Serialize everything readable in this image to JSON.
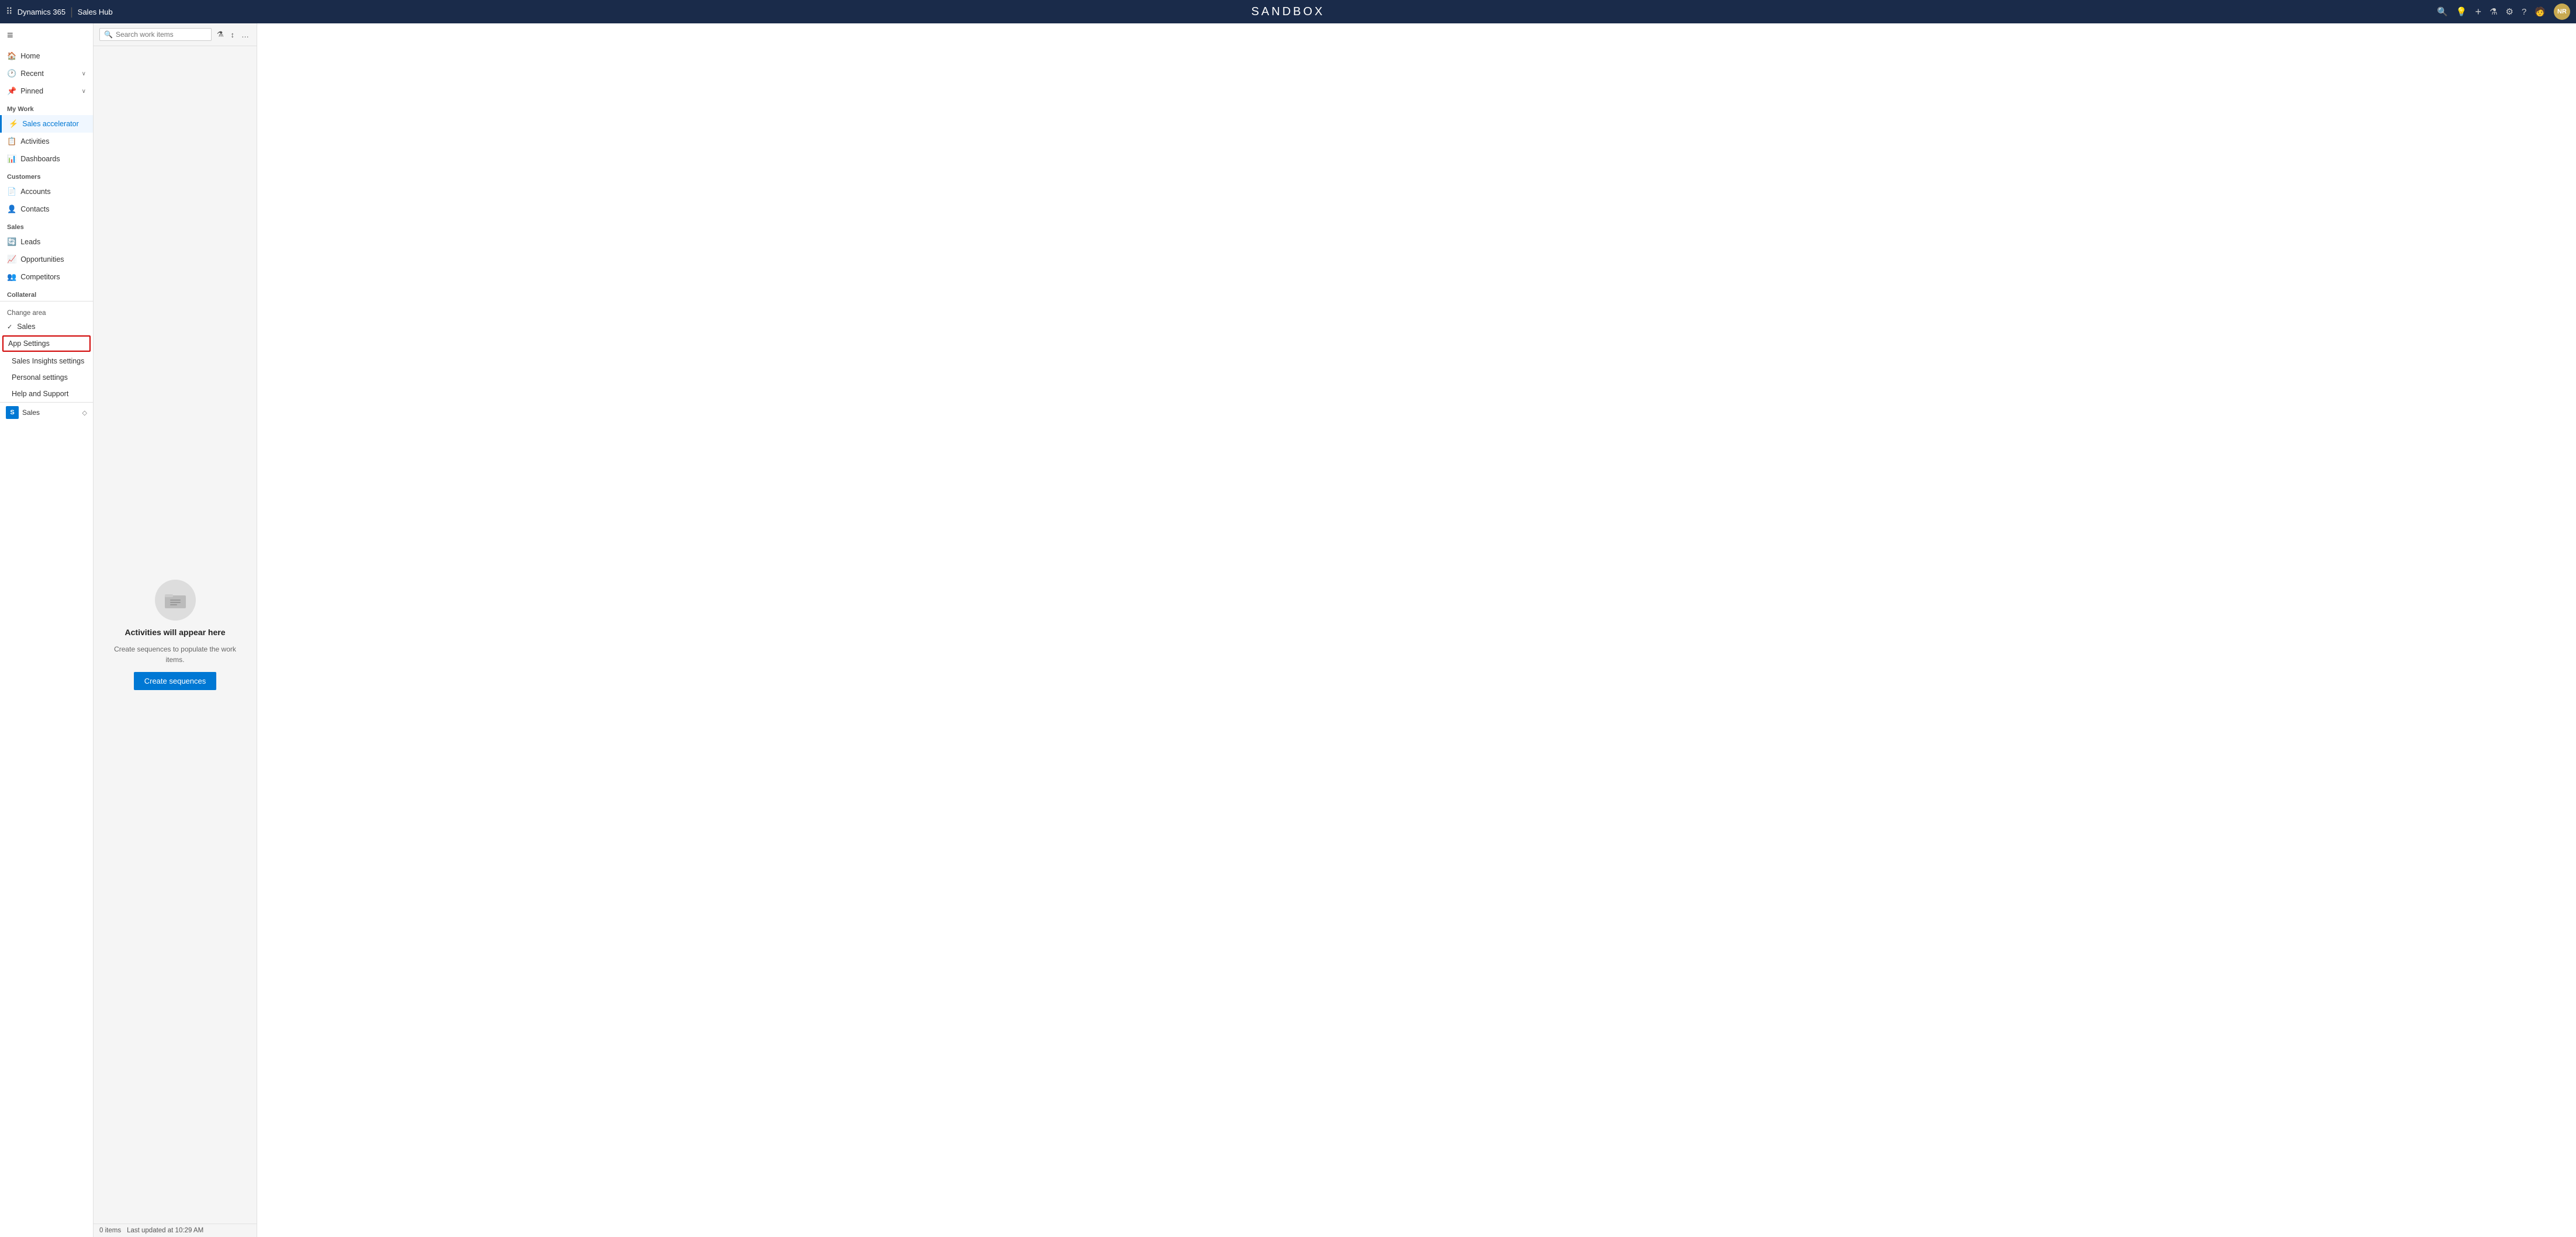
{
  "topNav": {
    "dotsIcon": "⠿",
    "brand": "Dynamics 365",
    "divider": "|",
    "appName": "Sales Hub",
    "title": "SANDBOX",
    "icons": {
      "search": "🔍",
      "lightbulb": "💡",
      "plus": "+",
      "filter": "⚗",
      "settings": "⚙",
      "help": "?",
      "person": "🧑"
    },
    "avatarLabel": "NR"
  },
  "sidebar": {
    "toggleIcon": "≡",
    "navItems": [
      {
        "id": "home",
        "label": "Home",
        "icon": "🏠"
      },
      {
        "id": "recent",
        "label": "Recent",
        "icon": "🕐",
        "expand": "∨"
      },
      {
        "id": "pinned",
        "label": "Pinned",
        "icon": "📌",
        "expand": "∨"
      }
    ],
    "myWorkLabel": "My Work",
    "myWorkItems": [
      {
        "id": "sales-accelerator",
        "label": "Sales accelerator",
        "icon": "⚡",
        "active": true
      },
      {
        "id": "activities",
        "label": "Activities",
        "icon": "📋"
      },
      {
        "id": "dashboards",
        "label": "Dashboards",
        "icon": "📊"
      }
    ],
    "customersLabel": "Customers",
    "customersItems": [
      {
        "id": "accounts",
        "label": "Accounts",
        "icon": "📄"
      },
      {
        "id": "contacts",
        "label": "Contacts",
        "icon": "👤"
      }
    ],
    "salesLabel": "Sales",
    "salesItems": [
      {
        "id": "leads",
        "label": "Leads",
        "icon": "🔄"
      },
      {
        "id": "opportunities",
        "label": "Opportunities",
        "icon": "📈"
      },
      {
        "id": "competitors",
        "label": "Competitors",
        "icon": "👥"
      }
    ],
    "collateralLabel": "Collateral",
    "changeAreaLabel": "Change area",
    "changeAreaItems": [
      {
        "id": "sales",
        "label": "Sales",
        "checked": true
      },
      {
        "id": "app-settings",
        "label": "App Settings",
        "highlighted": true
      }
    ],
    "subItems": [
      {
        "id": "sales-insights-settings",
        "label": "Sales Insights settings"
      },
      {
        "id": "personal-settings",
        "label": "Personal settings"
      },
      {
        "id": "help-and-support",
        "label": "Help and Support"
      }
    ]
  },
  "workPanel": {
    "searchPlaceholder": "Search work items",
    "filterIcon": "⚗",
    "sortIcon": "↕",
    "moreIcon": "…",
    "emptyIcon": "📁",
    "emptyTitle": "Activities will appear here",
    "emptySubtitle": "Create sequences to populate the work items.",
    "createButton": "Create sequences",
    "statusItems": "0 items",
    "statusTime": "Last updated at 10:29 AM"
  },
  "bottomBar": {
    "avatarLabel": "S",
    "label": "Sales",
    "expandIcon": "◇"
  }
}
